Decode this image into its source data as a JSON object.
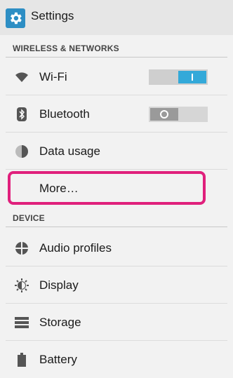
{
  "header": {
    "title": "Settings",
    "icon": "gear-icon"
  },
  "sections": {
    "wireless": "WIRELESS & NETWORKS",
    "device": "DEVICE"
  },
  "rows": {
    "wifi": {
      "label": "Wi-Fi",
      "icon": "wifi-icon",
      "toggle": "on"
    },
    "bluetooth": {
      "label": "Bluetooth",
      "icon": "bluetooth-icon",
      "toggle": "off"
    },
    "data_usage": {
      "label": "Data usage",
      "icon": "data-usage-icon"
    },
    "more": {
      "label": "More…"
    },
    "audio_profiles": {
      "label": "Audio profiles",
      "icon": "audio-profiles-icon"
    },
    "display": {
      "label": "Display",
      "icon": "display-icon"
    },
    "storage": {
      "label": "Storage",
      "icon": "storage-icon"
    },
    "battery": {
      "label": "Battery",
      "icon": "battery-icon"
    }
  },
  "colors": {
    "accent": "#33a9d9",
    "highlight": "#e0207c",
    "header_icon_bg": "#2d8ec4"
  }
}
